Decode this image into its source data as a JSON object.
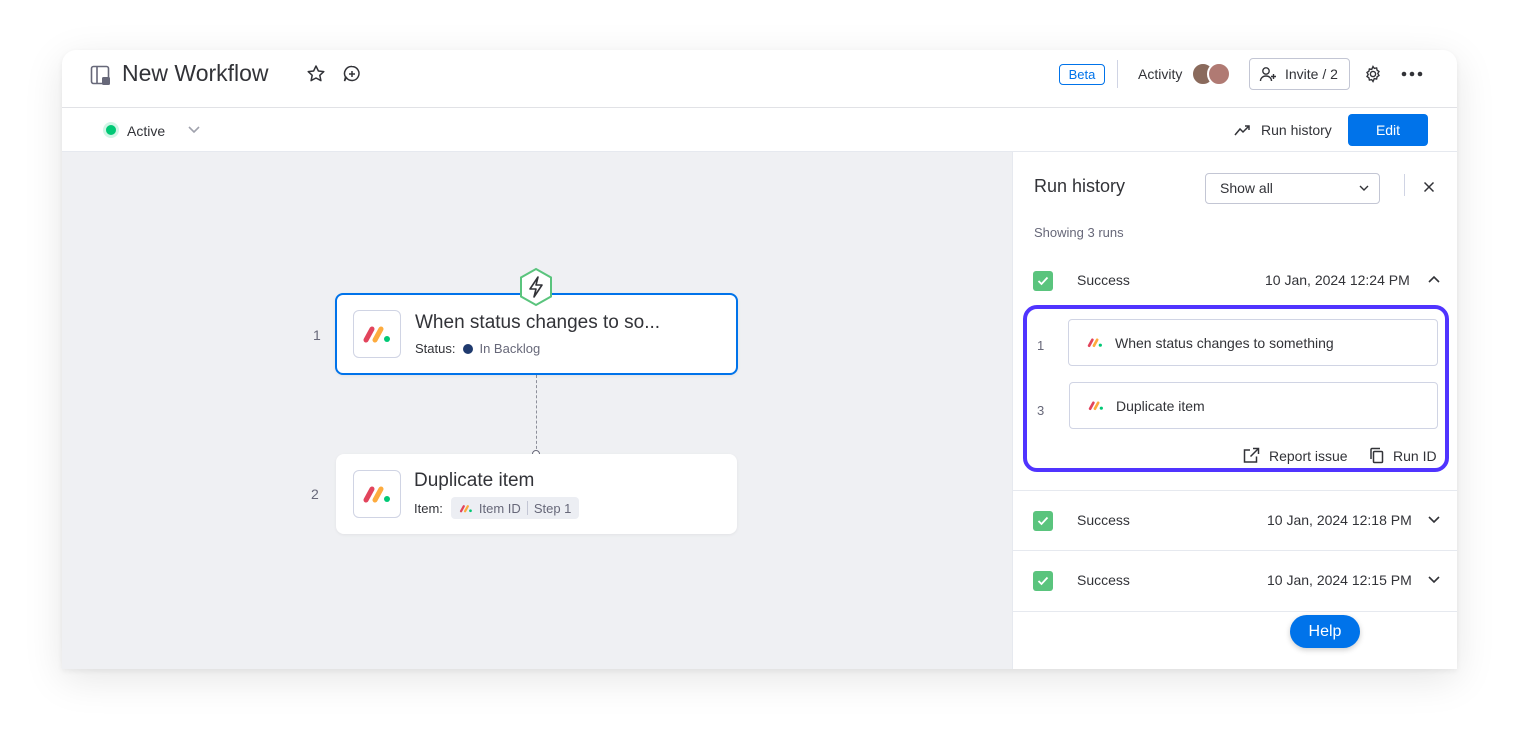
{
  "header": {
    "title": "New Workflow",
    "beta_label": "Beta",
    "activity_label": "Activity",
    "invite_label": "Invite / 2"
  },
  "toolbar": {
    "status_label": "Active",
    "run_history_label": "Run history",
    "edit_label": "Edit"
  },
  "canvas": {
    "steps": [
      {
        "number": "1",
        "title": "When status changes to so...",
        "field_label": "Status:",
        "field_value": "In Backlog"
      },
      {
        "number": "2",
        "title": "Duplicate item",
        "field_label": "Item:",
        "chip_left": "Item ID",
        "chip_right": "Step 1"
      }
    ]
  },
  "run_history": {
    "title": "Run history",
    "filter_value": "Show all",
    "summary": "Showing 3 runs",
    "runs": [
      {
        "status": "Success",
        "timestamp": "10 Jan, 2024 12:24 PM",
        "expanded": true,
        "steps": [
          {
            "number": "1",
            "label": "When status changes to something"
          },
          {
            "number": "3",
            "label": "Duplicate item"
          }
        ],
        "report_label": "Report issue",
        "run_id_label": "Run ID"
      },
      {
        "status": "Success",
        "timestamp": "10 Jan, 2024 12:18 PM",
        "expanded": false
      },
      {
        "status": "Success",
        "timestamp": "10 Jan, 2024 12:15 PM",
        "expanded": false
      }
    ]
  },
  "help": {
    "label": "Help"
  },
  "colors": {
    "primary": "#0073ea",
    "success": "#5ac47d",
    "active_green": "#00c875",
    "highlight": "#5034ff",
    "canvas_bg": "#eff0f3"
  },
  "icons": {
    "workflow": "workflow-icon",
    "star": "star-icon",
    "add_comment": "add-comment-icon",
    "invite": "add-user-icon",
    "settings": "gear-icon",
    "more": "more-icon",
    "trend": "trend-icon",
    "lightning": "lightning-icon",
    "external": "external-link-icon",
    "copy": "copy-icon",
    "close": "close-icon"
  }
}
